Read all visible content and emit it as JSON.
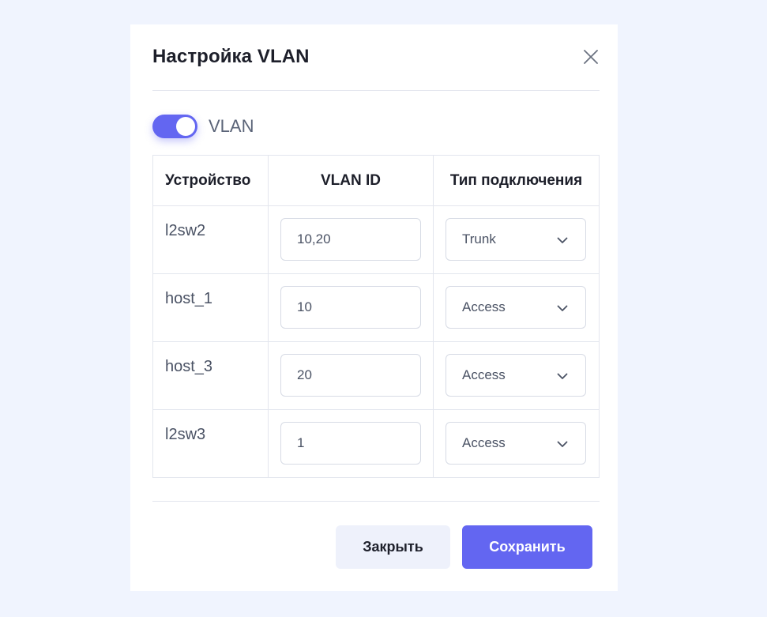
{
  "dialog": {
    "title": "Настройка VLAN",
    "close_icon": "close-icon"
  },
  "vlan_toggle": {
    "label": "VLAN",
    "enabled": true,
    "color": "#6366f1"
  },
  "table": {
    "headers": {
      "device": "Устройство",
      "vlan_id": "VLAN ID",
      "connection_type": "Тип подключения"
    },
    "rows": [
      {
        "device": "l2sw2",
        "vlan_id": "10,20",
        "connection_type": "Trunk"
      },
      {
        "device": "host_1",
        "vlan_id": "10",
        "connection_type": "Access"
      },
      {
        "device": "host_3",
        "vlan_id": "20",
        "connection_type": "Access"
      },
      {
        "device": "l2sw3",
        "vlan_id": "1",
        "connection_type": "Access"
      }
    ]
  },
  "footer": {
    "close_label": "Закрыть",
    "save_label": "Сохранить"
  },
  "colors": {
    "accent": "#6366f1",
    "background": "#f0f4fe"
  }
}
